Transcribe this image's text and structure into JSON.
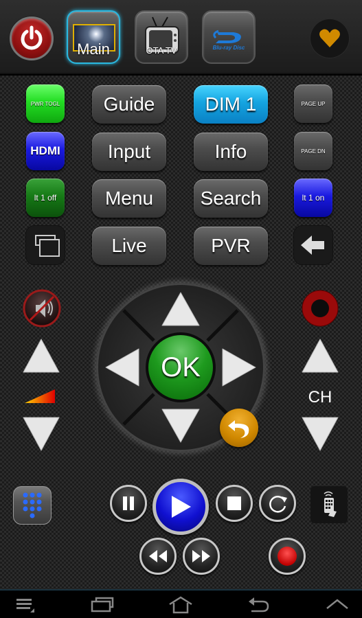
{
  "topbar": {
    "power_label": "Power",
    "devices": [
      {
        "label": "Main",
        "active": true,
        "icon": "lighthouse-thumbnail"
      },
      {
        "label": "OTA TV",
        "active": false,
        "icon": "retro-tv-icon"
      },
      {
        "label": "Blu-ray Disc",
        "active": false,
        "icon": "bluray-logo"
      }
    ],
    "bluray_text": "Blu-ray Disc",
    "favorite_icon": "heart-icon"
  },
  "buttons": {
    "pwr_togl": "PWR TOGL",
    "guide": "Guide",
    "dim1": "DIM 1",
    "page_up": "PAGE UP",
    "hdmi": "HDMI",
    "input": "Input",
    "info": "Info",
    "page_dn": "PAGE DN",
    "lt1off": "lt 1 off",
    "menu": "Menu",
    "search": "Search",
    "lt1on": "lt 1 on",
    "live": "Live",
    "pvr": "PVR"
  },
  "dpad": {
    "ok": "OK"
  },
  "channel": {
    "label": "CH"
  },
  "colors": {
    "accent_active_tab": "#2ab8e0",
    "power": "#8e1010",
    "ok_green": "#1e9a1e",
    "back_orange": "#d08800",
    "play_blue": "#1010d0",
    "record_red": "#e00000",
    "favorite": "#d08a00"
  },
  "navbar": {
    "items": [
      "menu",
      "recent-apps",
      "home",
      "back",
      "up"
    ]
  }
}
